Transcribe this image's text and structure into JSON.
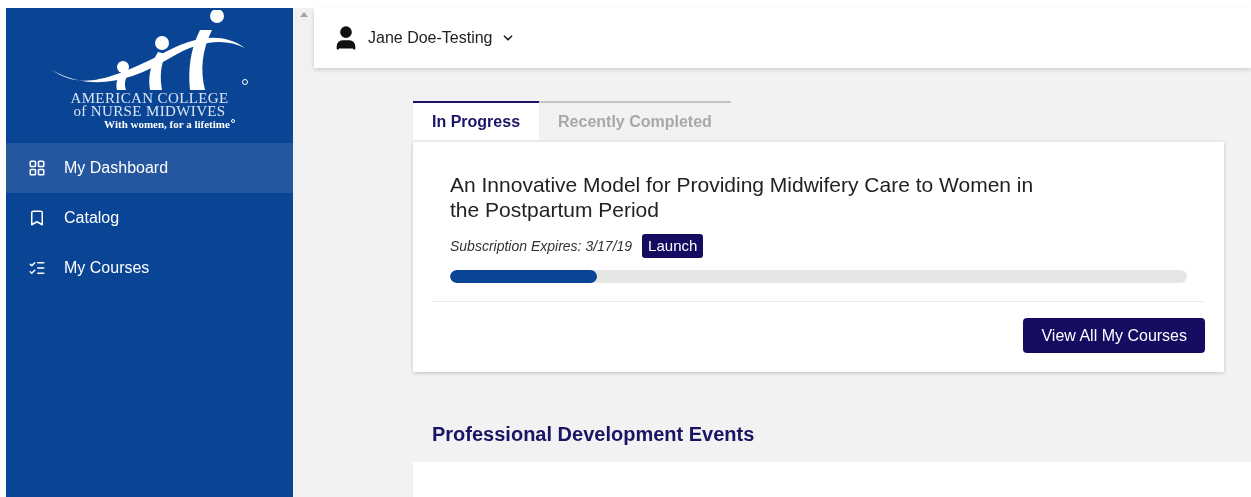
{
  "logo": {
    "lines": [
      "AMERICAN COLLEGE",
      "of NURSE MIDWIVES"
    ],
    "tagline": "With women, for a lifetime"
  },
  "sidebar": {
    "items": [
      {
        "label": "My Dashboard",
        "selected": true
      },
      {
        "label": "Catalog",
        "selected": false
      },
      {
        "label": "My Courses",
        "selected": false
      }
    ]
  },
  "header": {
    "user": "Jane Doe-Testing"
  },
  "tabs": [
    {
      "label": "In Progress",
      "selected": true
    },
    {
      "label": "Recently Completed",
      "selected": false
    }
  ],
  "course": {
    "title": "An Innovative Model for Providing Midwifery Care to Women in the Postpartum Period",
    "expires": "Subscription Expires: 3/17/19",
    "launch": "Launch",
    "level": 0.2
  },
  "view_all": "View All My Courses",
  "section_title": "Professional Development Events"
}
